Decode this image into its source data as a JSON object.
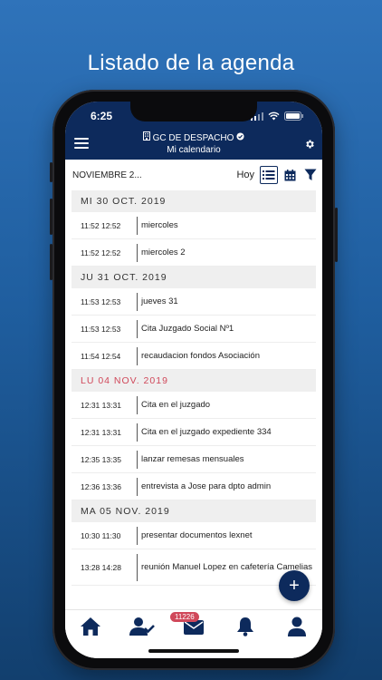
{
  "headline": "Listado de la agenda",
  "status": {
    "time": "6:25"
  },
  "appbar": {
    "title": "GC DE DESPACHO",
    "subtitle": "Mi calendario"
  },
  "toolbar": {
    "month": "NOVIEMBRE 2...",
    "today_label": "Hoy"
  },
  "days": [
    {
      "label": "MI 30 OCT. 2019",
      "today": false,
      "events": [
        {
          "start": "11:52",
          "end": "12:52",
          "title": "miercoles"
        },
        {
          "start": "11:52",
          "end": "12:52",
          "title": "miercoles 2"
        }
      ]
    },
    {
      "label": "JU 31 OCT. 2019",
      "today": false,
      "events": [
        {
          "start": "11:53",
          "end": "12:53",
          "title": "jueves 31"
        },
        {
          "start": "11:53",
          "end": "12:53",
          "title": "Cita Juzgado Social Nº1"
        },
        {
          "start": "11:54",
          "end": "12:54",
          "title": "recaudacion fondos Asociación"
        }
      ]
    },
    {
      "label": "LU 04 NOV. 2019",
      "today": true,
      "events": [
        {
          "start": "12:31",
          "end": "13:31",
          "title": "Cita en el juzgado"
        },
        {
          "start": "12:31",
          "end": "13:31",
          "title": "Cita en el juzgado expediente 334"
        },
        {
          "start": "12:35",
          "end": "13:35",
          "title": "lanzar remesas mensuales"
        },
        {
          "start": "12:36",
          "end": "13:36",
          "title": "entrevista a Jose para dpto admin"
        }
      ]
    },
    {
      "label": "MA 05 NOV. 2019",
      "today": false,
      "events": [
        {
          "start": "10:30",
          "end": "11:30",
          "title": "presentar documentos lexnet"
        },
        {
          "start": "13:28",
          "end": "14:28",
          "title": "reunión Manuel Lopez en cafetería Camelias"
        }
      ]
    }
  ],
  "fab_label": "+",
  "nav": {
    "mail_badge": "11226"
  },
  "colors": {
    "primary": "#0d2a5c",
    "today": "#d0485a",
    "day_header_bg": "#efefef"
  }
}
